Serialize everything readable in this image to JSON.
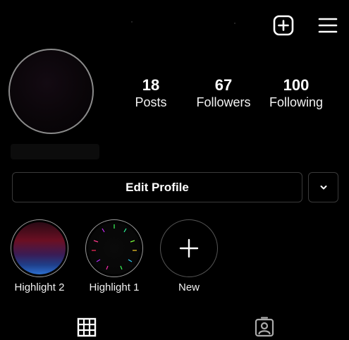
{
  "header": {
    "new_post_icon": "plus-square-icon",
    "menu_icon": "hamburger-menu-icon"
  },
  "profile": {
    "avatar": "profile-avatar",
    "stats": {
      "posts": {
        "value": "18",
        "label": "Posts"
      },
      "followers": {
        "value": "67",
        "label": "Followers"
      },
      "following": {
        "value": "100",
        "label": "Following"
      }
    }
  },
  "actions": {
    "edit_profile_label": "Edit Profile",
    "more_icon": "chevron-down-icon"
  },
  "highlights": [
    {
      "label": "Highlight 2"
    },
    {
      "label": "Highlight 1"
    },
    {
      "label": "New",
      "icon": "plus-icon"
    }
  ],
  "tabs": [
    {
      "icon": "grid-icon"
    },
    {
      "icon": "tagged-person-icon"
    }
  ],
  "colors": {
    "background": "#000000",
    "text": "#ffffff",
    "border": "#3a3a3a"
  }
}
